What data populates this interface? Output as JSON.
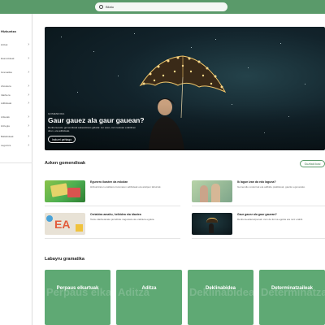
{
  "search": {
    "value": "Bilatu"
  },
  "sidebar": {
    "title": "Hizkuntza",
    "items": [
      {
        "label": "Hitzak"
      },
      {
        "label": "Esamoldeak"
      },
      {
        "label": "Gramatika"
      },
      {
        "label": "Ahoskera"
      },
      {
        "label": "Idazkera"
      },
      {
        "label": "Adibideak"
      },
      {
        "label": "Ariketak"
      },
      {
        "label": "Hiztegia"
      },
      {
        "label": "Baliabideak"
      },
      {
        "label": "Laguntza"
      }
    ]
  },
  "hero": {
    "kicker": "GOMENDIOA",
    "title": "Gaur gauez ala gaur gauean?",
    "description": "Denbora-testu gomendioak aukeratzeko gidaria: zer esan, zein testuan erabiltzen diren, eta adibideak.",
    "button": "Irakurri gehiago"
  },
  "recommendations": {
    "title": "Azken gomendioak",
    "see_all": "Guztiak ikusi",
    "items": [
      {
        "title": "Egunero ikasten da eskolan",
        "description": "Hizkuntzaren erabilera zuzenaren adibideak eta azalpen laburrak."
      },
      {
        "title": "Ik lagun izan da edo laguna?",
        "description": "Gomendio orokorrak eta adibide praktikoak, gaurko egunerako."
      },
      {
        "title": "Orrialdea amaitu, helbidea eta idaztea",
        "description": "Testu-idazketarako jarraibide nagusiak eta erabilera egokia."
      },
      {
        "title": "Gaur gauez ala gaur gauean?",
        "description": "Denbora-adierazpenak: zein da forma egokia eta noiz erabili."
      }
    ]
  },
  "grammar": {
    "title": "Labayru gramatika",
    "cards": [
      {
        "label": "Perpaus elkartuak",
        "watermark": "Perpaus elkartuak"
      },
      {
        "label": "Aditza",
        "watermark": "Aditza"
      },
      {
        "label": "Deklinabidea",
        "watermark": "Deklinabidea"
      },
      {
        "label": "Determinatzaileak",
        "watermark": "Determinatzaileak"
      }
    ]
  },
  "colors": {
    "accent": "#5a9a6a",
    "card": "#5fa974"
  }
}
